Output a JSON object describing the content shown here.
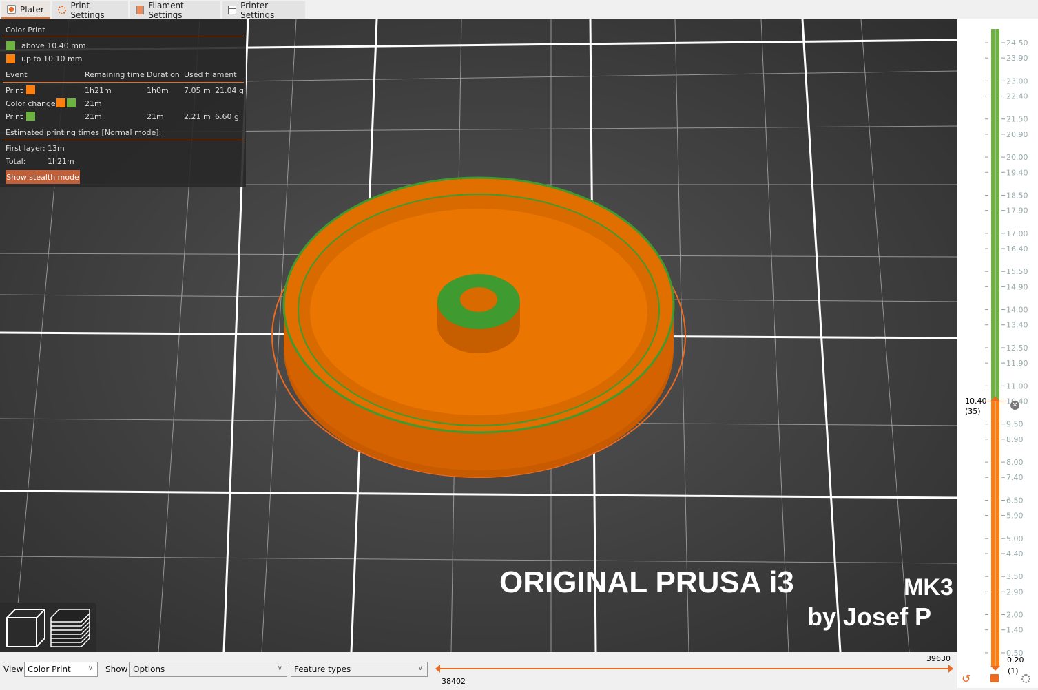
{
  "tabs": [
    {
      "label": "Plater",
      "active": true
    },
    {
      "label": "Print Settings"
    },
    {
      "label": "Filament Settings"
    },
    {
      "label": "Printer Settings"
    }
  ],
  "legend": {
    "title": "Color Print",
    "ranges": [
      {
        "label": "above 10.40 mm",
        "color": "#6db33f"
      },
      {
        "label": "up to 10.10 mm",
        "color": "#ff7f0e"
      }
    ],
    "headers": [
      "Event",
      "Remaining time",
      "Duration",
      "Used filament"
    ],
    "rows": [
      {
        "event": "Print",
        "colors": [
          "#ff7f0e"
        ],
        "remaining": "1h21m",
        "duration": "1h0m",
        "length": "7.05 m",
        "weight": "21.04 g"
      },
      {
        "event": "Color change",
        "colors": [
          "#ff7f0e",
          "#6db33f"
        ],
        "remaining": "21m",
        "duration": "",
        "length": "",
        "weight": ""
      },
      {
        "event": "Print",
        "colors": [
          "#6db33f"
        ],
        "remaining": "21m",
        "duration": "21m",
        "length": "2.21 m",
        "weight": "6.60 g"
      }
    ],
    "estimated": "Estimated printing times [Normal mode]:",
    "first_layer_label": "First layer:",
    "first_layer": "13m",
    "total_label": "Total:",
    "total": "1h21m",
    "stealth_button": "Show stealth mode"
  },
  "bed_text": {
    "line1": "ORIGINAL PRUSA i3",
    "line1b": "MK3",
    "line2": "by Josef P"
  },
  "vertical_slider": {
    "labels": [
      "24.50",
      "23.90",
      "23.00",
      "22.40",
      "21.50",
      "20.90",
      "20.00",
      "19.40",
      "18.50",
      "17.90",
      "17.00",
      "16.40",
      "15.50",
      "14.90",
      "14.00",
      "13.40",
      "12.50",
      "11.90",
      "11.00",
      "10.40",
      "9.50",
      "8.90",
      "8.00",
      "7.40",
      "6.50",
      "5.90",
      "5.00",
      "4.40",
      "3.50",
      "2.90",
      "2.00",
      "1.40",
      "0.50"
    ],
    "max": 24.5,
    "min": 0.2,
    "upper_value": "10.40",
    "upper_layer": "(35)",
    "lower_value": "0.20",
    "lower_layer": "(1)",
    "colors": {
      "above": "#6db33f",
      "below": "#ff7f0e"
    }
  },
  "bottom": {
    "view_label": "View",
    "view_value": "Color Print",
    "show_label": "Show",
    "show_value": "Options",
    "features_value": "Feature types",
    "h_slider_max": "39630",
    "h_slider_min": "38402"
  }
}
